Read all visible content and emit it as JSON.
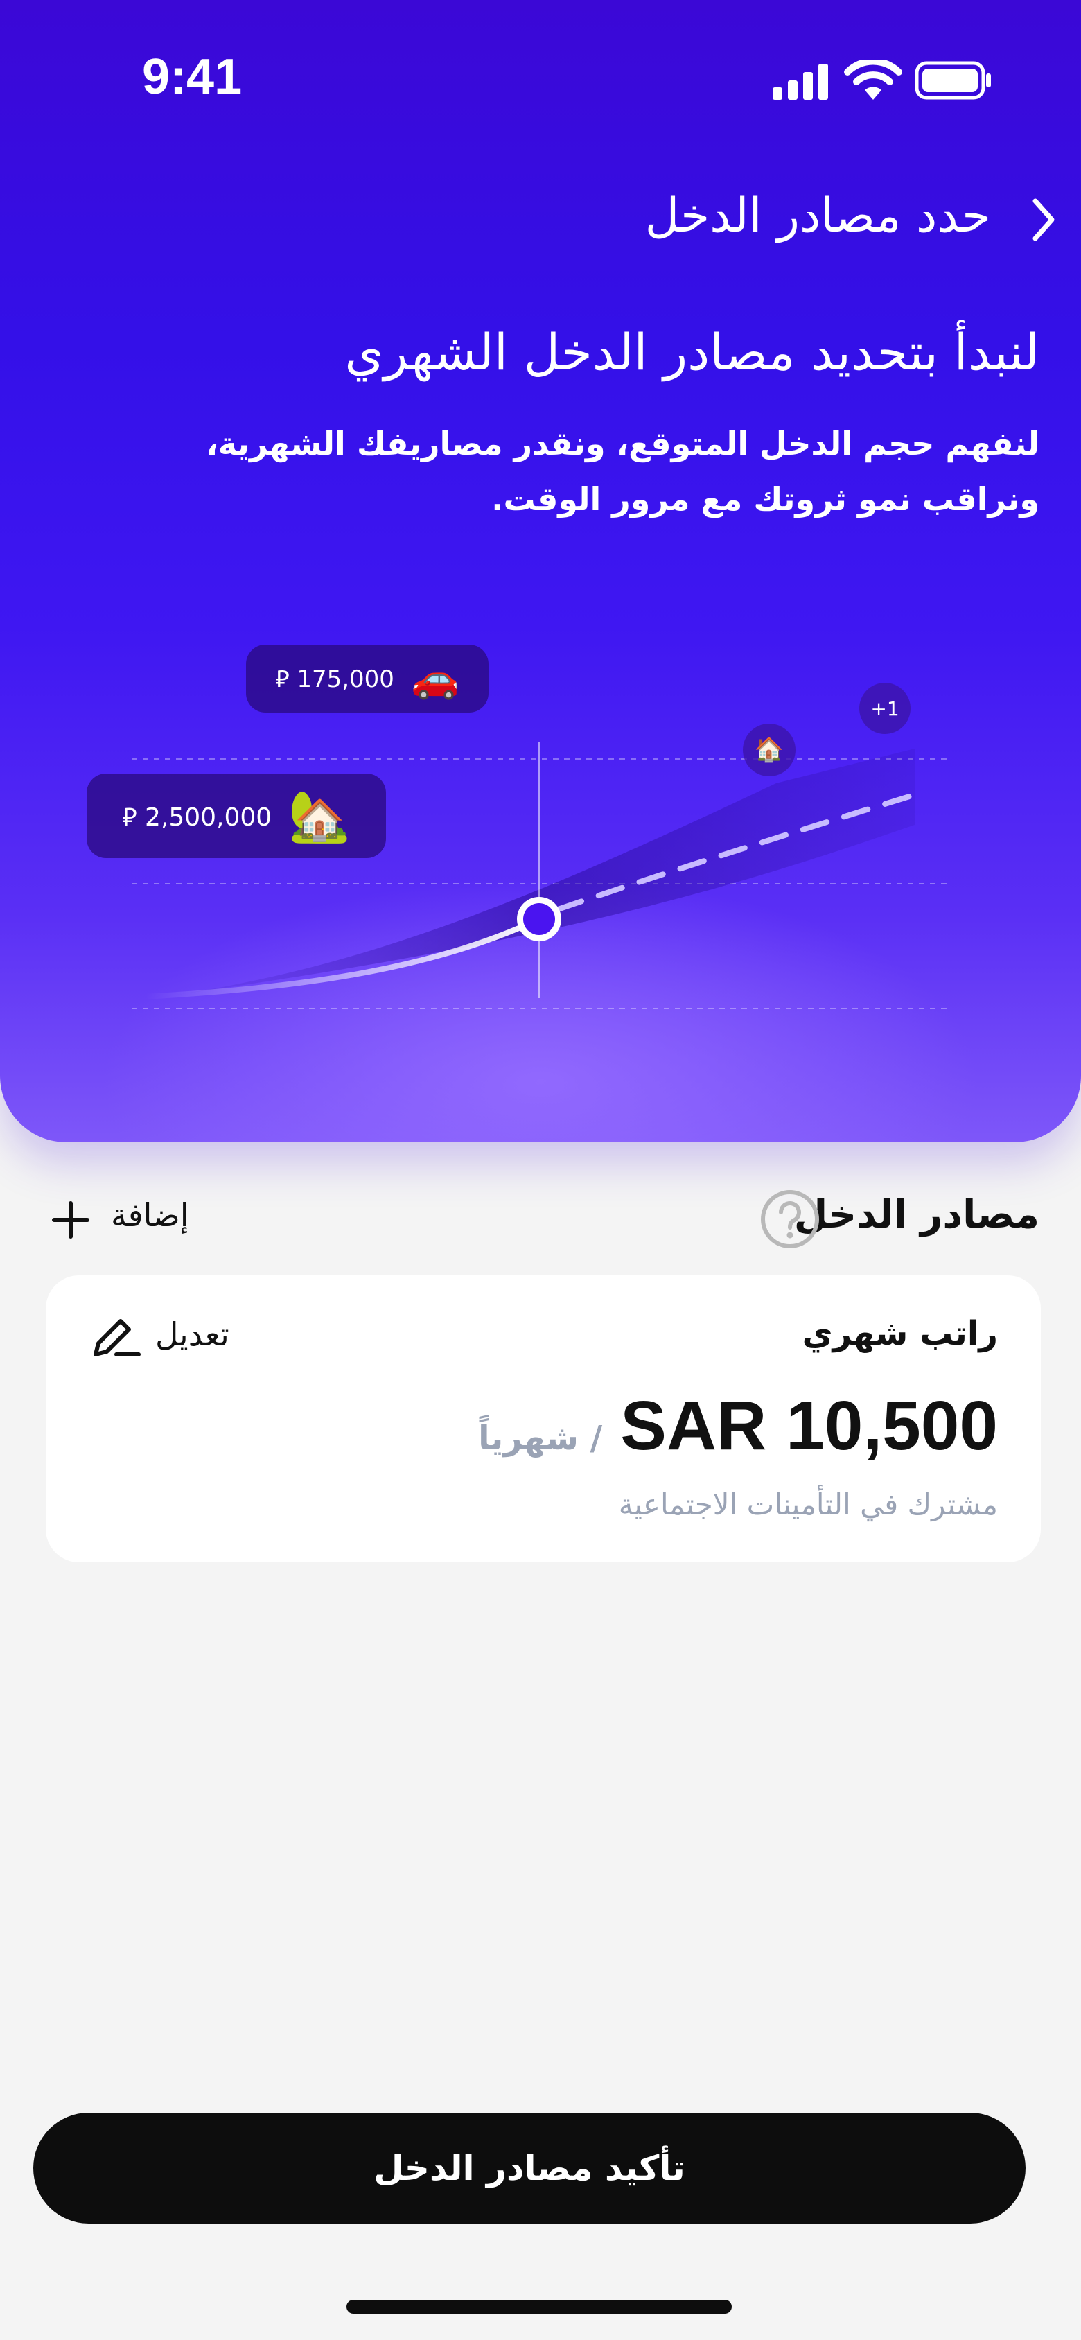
{
  "status_bar": {
    "time": "9:41"
  },
  "header": {
    "title": "حدد مصادر الدخل"
  },
  "hero": {
    "heading": "لنبدأ بتحديد مصادر الدخل الشهري",
    "subtitle": "لنفهم حجم الدخل المتوقع، ونقدر مصاريفك الشهرية، ونراقب نمو ثروتك مع مرور الوقت."
  },
  "chart_visual": {
    "car_value": "175,000",
    "house_value": "2,500,000",
    "currency_symbol": "⃁",
    "car_emoji": "🚗",
    "house_emoji": "🏡",
    "home_marker_emoji": "🏠",
    "more_marker": "+1"
  },
  "section": {
    "title": "مصادر الدخل",
    "add_label": "إضافة"
  },
  "income_card": {
    "title": "راتب شهري",
    "edit_label": "تعديل",
    "amount": "SAR 10,500",
    "unit": "/ شهرياً",
    "note": "مشترك في التأمينات الاجتماعية"
  },
  "footer": {
    "confirm_label": "تأكيد مصادر الدخل"
  },
  "colors": {
    "hero_top": "#3b08d6",
    "hero_bottom": "#7e57f9",
    "accent": "#4a14f0",
    "button": "#0d0d0d",
    "muted_text": "#9aa3b5"
  }
}
